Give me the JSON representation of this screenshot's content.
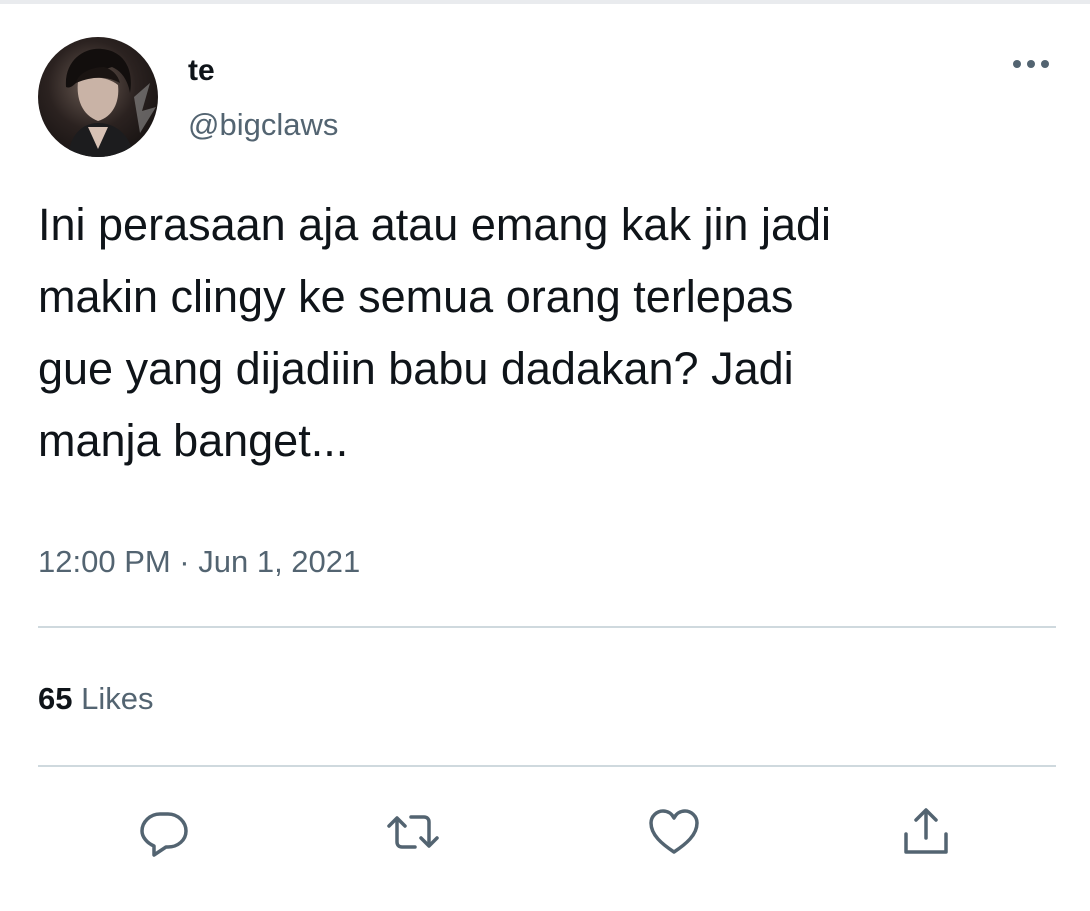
{
  "tweet": {
    "author": {
      "display_name": "te",
      "handle": "@bigclaws"
    },
    "text": "Ini perasaan aja atau emang kak jin jadi\nmakin clingy ke semua orang terlepas\ngue yang dijadiin babu dadakan? Jadi\nmanja banget...",
    "timestamp": "12:00 PM · Jun 1, 2021",
    "stats": {
      "likes_count": "65",
      "likes_label": "Likes"
    }
  },
  "icons": {
    "menu": "more-horizontal-icon",
    "reply": "reply-icon",
    "retweet": "retweet-icon",
    "like": "heart-icon",
    "share": "share-icon"
  },
  "colors": {
    "primary_text": "#0f1419",
    "secondary_text": "#536471",
    "divider": "#cfd9de"
  }
}
